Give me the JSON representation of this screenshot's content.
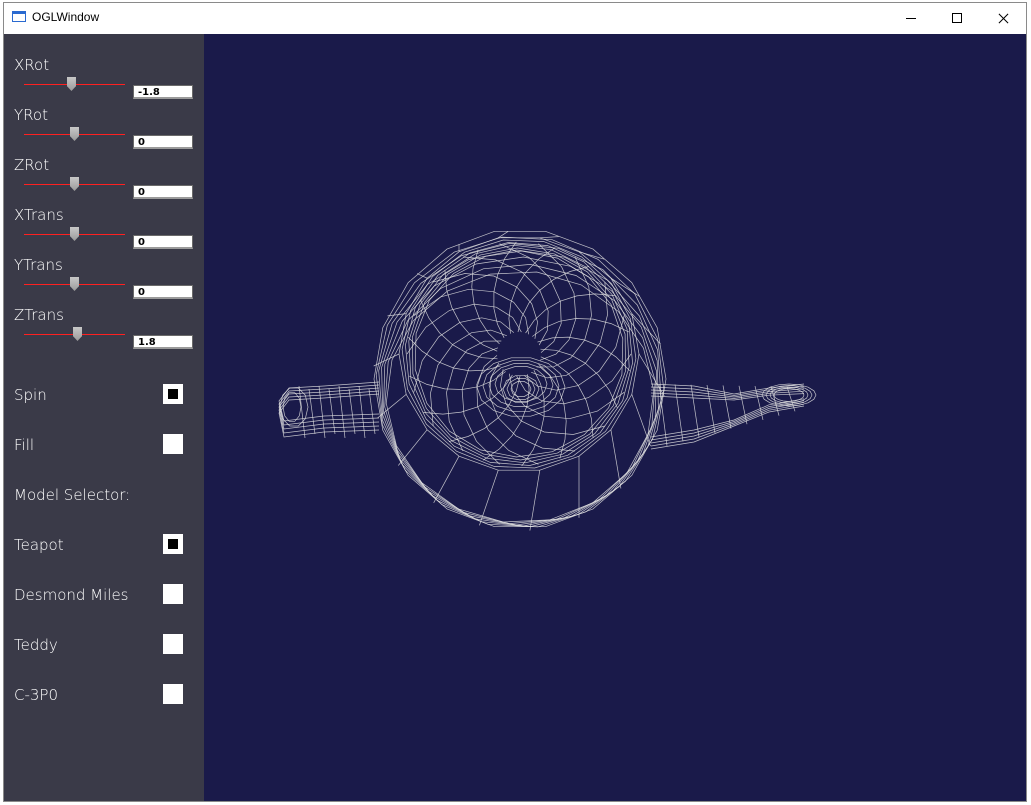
{
  "window": {
    "title": "OGLWindow"
  },
  "sliders": [
    {
      "label": "XRot",
      "value": "-1.8",
      "fraction": 0.47
    },
    {
      "label": "YRot",
      "value": "0",
      "fraction": 0.5
    },
    {
      "label": "ZRot",
      "value": "0",
      "fraction": 0.5
    },
    {
      "label": "XTrans",
      "value": "0",
      "fraction": 0.5
    },
    {
      "label": "YTrans",
      "value": "0",
      "fraction": 0.5
    },
    {
      "label": "ZTrans",
      "value": "1.8",
      "fraction": 0.53
    }
  ],
  "options": {
    "spin": {
      "label": "Spin",
      "checked": true
    },
    "fill": {
      "label": "Fill",
      "checked": false
    }
  },
  "model_selector": {
    "heading": "Model Selector:",
    "models": [
      {
        "label": "Teapot",
        "checked": true
      },
      {
        "label": "Desmond Miles",
        "checked": false
      },
      {
        "label": "Teddy",
        "checked": false
      },
      {
        "label": "C-3P0",
        "checked": false
      }
    ]
  },
  "colors": {
    "sidebar_bg": "#3a3a48",
    "viewport_bg": "#1a1a4a",
    "slider_track": "#ff2020",
    "wireframe": "#e0e0e0"
  }
}
